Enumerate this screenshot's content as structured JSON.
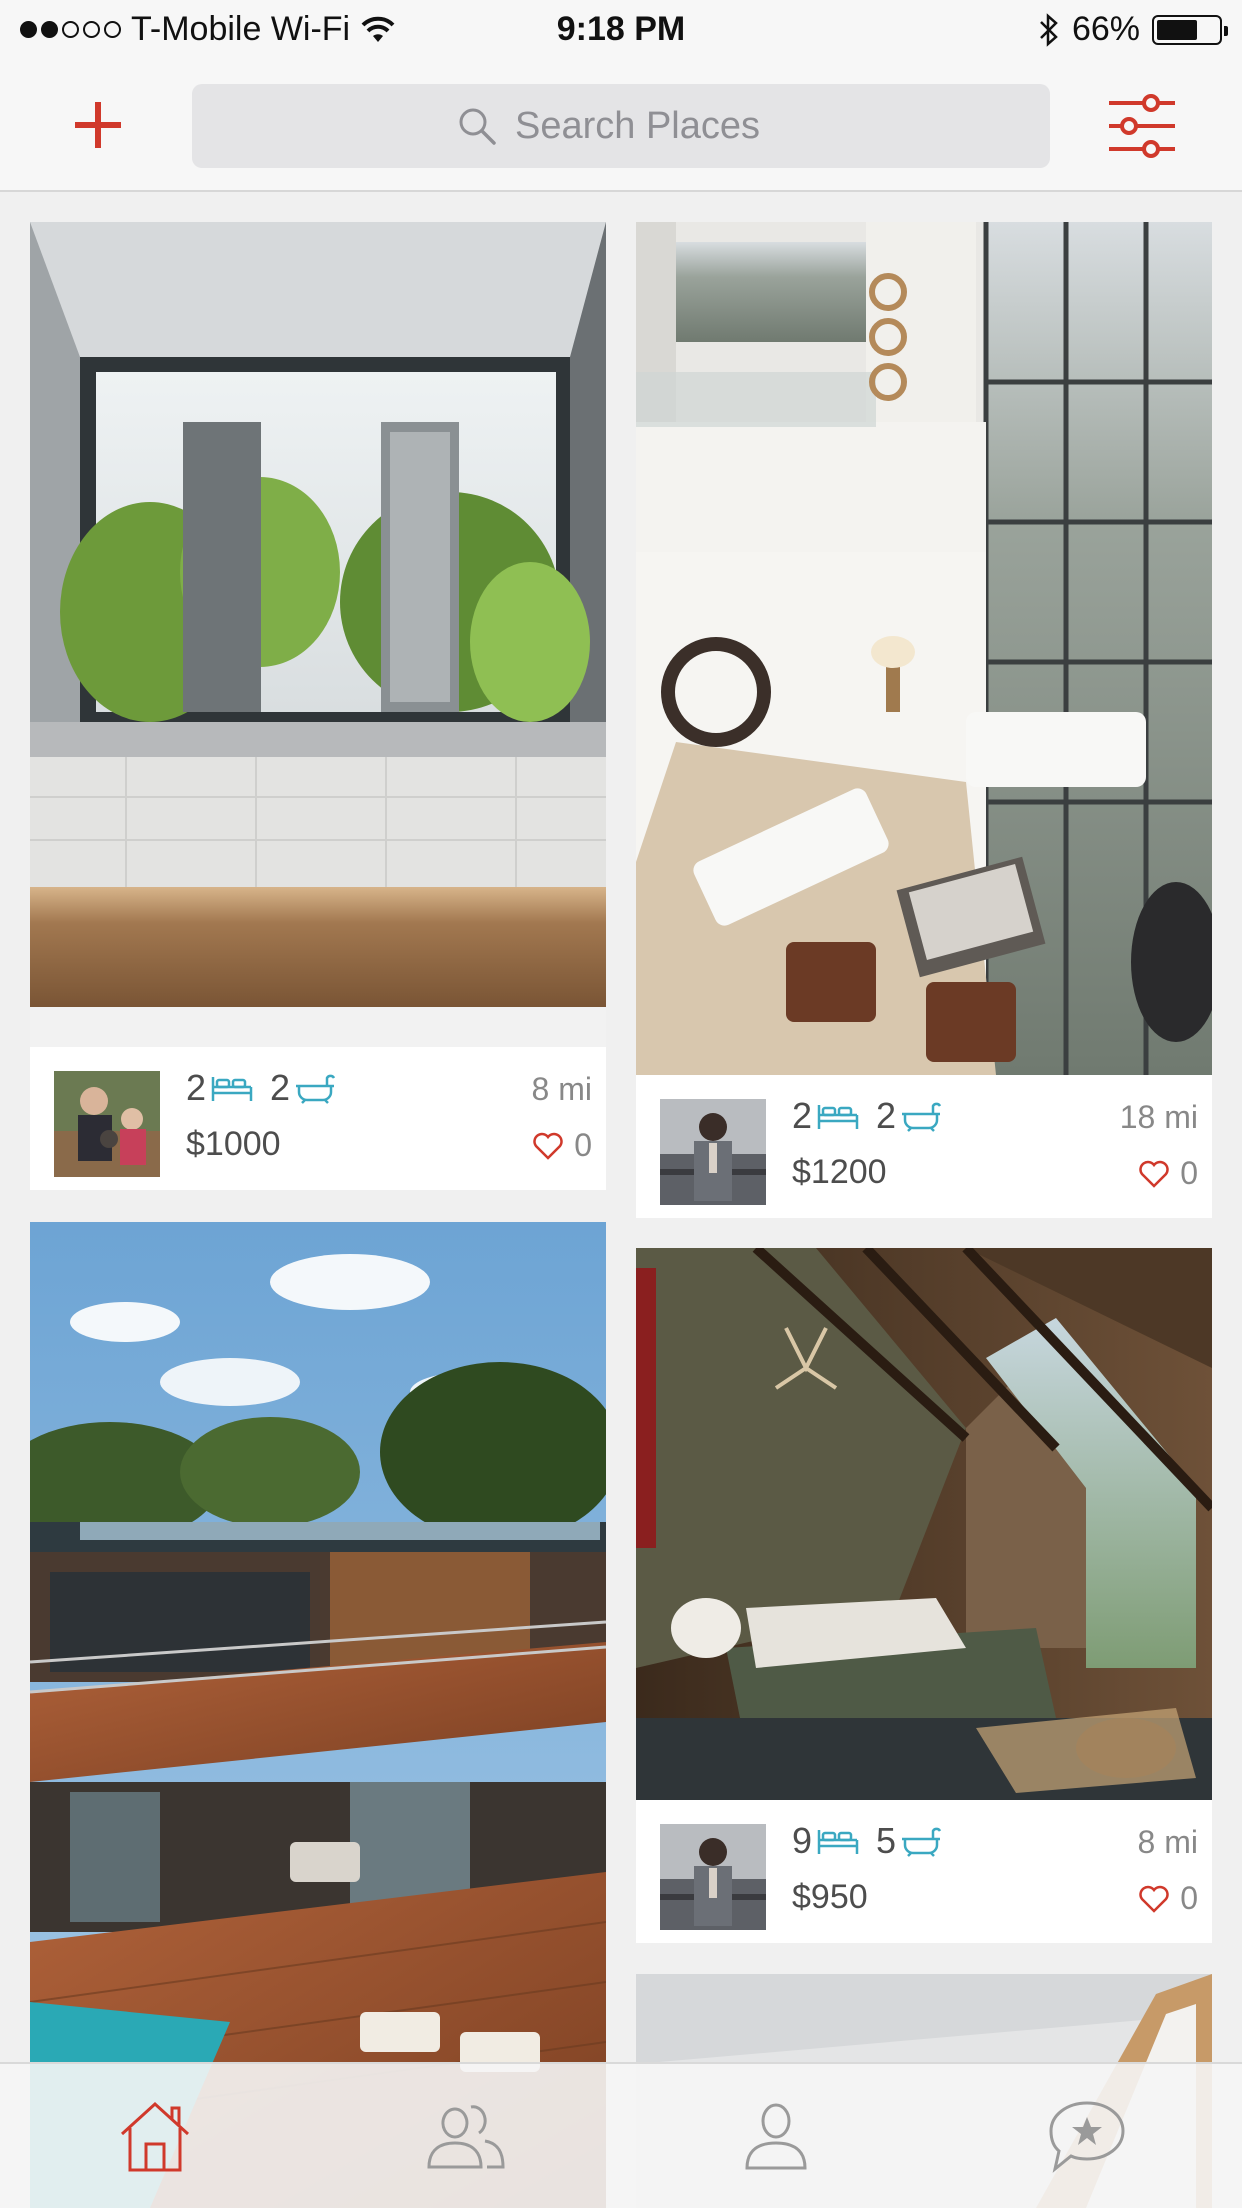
{
  "status_bar": {
    "carrier": "T-Mobile Wi-Fi",
    "time": "9:18 PM",
    "battery": "66%",
    "battery_level": 0.66,
    "signal_bars_filled": 2,
    "signal_bars_total": 5
  },
  "header": {
    "add_icon": "plus-icon",
    "search_placeholder": "Search Places",
    "filter_icon": "sliders-icon"
  },
  "colors": {
    "accent": "#d0392b",
    "amenity_icon": "#3aa8c1",
    "heart": "#d0392b"
  },
  "listings": [
    {
      "beds": "2",
      "baths": "2",
      "price": "$1000",
      "distance": "8 mi",
      "likes": "0"
    },
    {
      "beds": "2",
      "baths": "2",
      "price": "$1200",
      "distance": "18 mi",
      "likes": "0"
    },
    {
      "beds": "9",
      "baths": "5",
      "price": "$950",
      "distance": "8 mi",
      "likes": "0"
    }
  ],
  "tabs": [
    {
      "icon": "home-icon",
      "active": true
    },
    {
      "icon": "people-icon",
      "active": false
    },
    {
      "icon": "profile-icon",
      "active": false
    },
    {
      "icon": "favorites-chat-icon",
      "active": false
    }
  ]
}
